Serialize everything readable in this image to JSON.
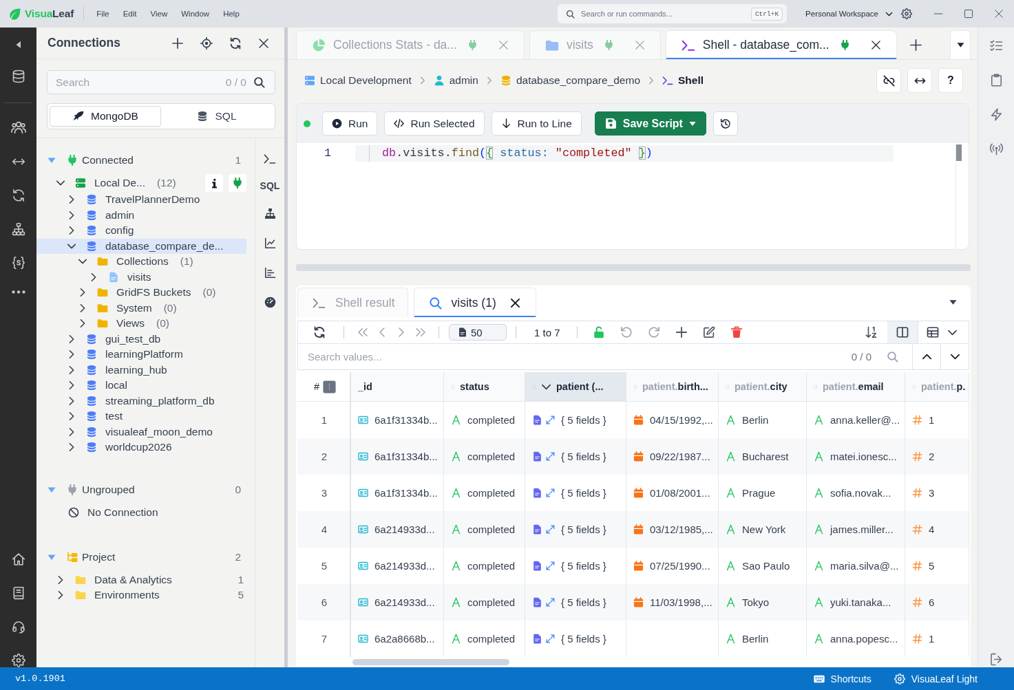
{
  "title_bar": {
    "logo": {
      "prefix": "Visua",
      "suffix": "Leaf"
    },
    "menu": [
      "File",
      "Edit",
      "View",
      "Window",
      "Help"
    ],
    "command_search": {
      "placeholder": "Search or run commands...",
      "shortcut": "Ctrl+K"
    },
    "workspace": "Personal Workspace"
  },
  "connections_panel": {
    "title": "Connections",
    "search": {
      "placeholder": "Search",
      "count": "0 / 0"
    },
    "db_types": [
      {
        "label": "MongoDB",
        "kind": "mongodb",
        "selected": true
      },
      {
        "label": "SQL",
        "kind": "sql",
        "selected": false
      }
    ],
    "tool_label": "SQL",
    "groups": [
      {
        "name": "Connected",
        "kind": "connected",
        "count": "1",
        "expanded": true,
        "children": [
          {
            "name": "Local De...",
            "kind": "server",
            "count": "(12)",
            "expanded": true,
            "selected": false,
            "children": [
              {
                "name": "TravelPlannerDemo",
                "kind": "database",
                "expanded": false,
                "selected": false
              },
              {
                "name": "admin",
                "kind": "database",
                "expanded": false,
                "selected": false
              },
              {
                "name": "config",
                "kind": "database",
                "expanded": false,
                "selected": false
              },
              {
                "name": "database_compare_de...",
                "kind": "database",
                "expanded": true,
                "selected": true,
                "children": [
                  {
                    "name": "Collections",
                    "kind": "folder",
                    "count": "(1)",
                    "expanded": true,
                    "selected": false,
                    "children": [
                      {
                        "name": "visits",
                        "kind": "collection",
                        "expanded": false,
                        "selected": false
                      }
                    ]
                  },
                  {
                    "name": "GridFS Buckets",
                    "kind": "folder",
                    "count": "(0)",
                    "expanded": false,
                    "selected": false
                  },
                  {
                    "name": "System",
                    "kind": "folder",
                    "count": "(0)",
                    "expanded": false,
                    "selected": false
                  },
                  {
                    "name": "Views",
                    "kind": "folder",
                    "count": "(0)",
                    "expanded": false,
                    "selected": false
                  }
                ]
              },
              {
                "name": "gui_test_db",
                "kind": "database",
                "expanded": false,
                "selected": false
              },
              {
                "name": "learningPlatform",
                "kind": "database",
                "expanded": false,
                "selected": false
              },
              {
                "name": "learning_hub",
                "kind": "database",
                "expanded": false,
                "selected": false
              },
              {
                "name": "local",
                "kind": "database",
                "expanded": false,
                "selected": false
              },
              {
                "name": "streaming_platform_db",
                "kind": "database",
                "expanded": false,
                "selected": false
              },
              {
                "name": "test",
                "kind": "database",
                "expanded": false,
                "selected": false
              },
              {
                "name": "visualeaf_moon_demo",
                "kind": "database",
                "expanded": false,
                "selected": false
              },
              {
                "name": "worldcup2026",
                "kind": "database",
                "expanded": false,
                "selected": false
              }
            ]
          }
        ]
      },
      {
        "name": "Ungrouped",
        "kind": "ungrouped",
        "count": "0",
        "expanded": true,
        "children": [
          {
            "name": "No Connection",
            "kind": "empty"
          }
        ]
      },
      {
        "name": "Project",
        "kind": "project",
        "count": "2",
        "expanded": true,
        "children": [
          {
            "name": "Data & Analytics",
            "kind": "project_folder",
            "count": "1",
            "expanded": false,
            "selected": false
          },
          {
            "name": "Environments",
            "kind": "project_folder",
            "count": "5",
            "expanded": false,
            "selected": false
          }
        ]
      }
    ]
  },
  "editor_tabs": [
    {
      "label": "Collections Stats - da...",
      "kind": "stats",
      "selected": false
    },
    {
      "label": "visits",
      "kind": "collection",
      "selected": false
    },
    {
      "label": "Shell - database_com...",
      "kind": "shell",
      "selected": true
    }
  ],
  "breadcrumb": [
    {
      "label": "Local Development",
      "kind": "server"
    },
    {
      "label": "admin",
      "kind": "user"
    },
    {
      "label": "database_compare_demo",
      "kind": "database"
    },
    {
      "label": "Shell",
      "kind": "shell"
    }
  ],
  "help_button": "?",
  "editor": {
    "connected": true,
    "buttons": [
      {
        "label": "Run",
        "kind": "run"
      },
      {
        "label": "Run Selected",
        "kind": "run_selected"
      },
      {
        "label": "Run to Line",
        "kind": "run_to_line"
      },
      {
        "label": "Save Script",
        "kind": "save"
      }
    ],
    "lines": [
      {
        "number": "1",
        "tokens": [
          {
            "text": "db",
            "kind": "keyword"
          },
          {
            "text": ".visits.",
            "kind": "plain"
          },
          {
            "text": "find",
            "kind": "function"
          },
          {
            "text": "(",
            "kind": "paren"
          },
          {
            "text": "{",
            "kind": "brace"
          },
          {
            "text": " status: ",
            "kind": "property"
          },
          {
            "text": "\"completed\" ",
            "kind": "string"
          },
          {
            "text": "}",
            "kind": "brace"
          },
          {
            "text": ")",
            "kind": "paren"
          }
        ]
      }
    ]
  },
  "results": {
    "tabs": [
      {
        "label": "Shell result",
        "kind": "shell",
        "selected": false
      },
      {
        "label": "visits (1)",
        "kind": "query",
        "selected": true
      }
    ],
    "page_size": "50",
    "range": "1 to 7",
    "locked": false,
    "columns_panel_on": true,
    "search": {
      "placeholder": "Search values...",
      "count": "0 / 0"
    },
    "table": {
      "index_header": "#",
      "columns": [
        {
          "label": "_id",
          "kind": "id"
        },
        {
          "label": "status",
          "kind": "field"
        },
        {
          "label": "patient (...",
          "kind": "object",
          "expanded": true
        },
        {
          "prefix": "patient.",
          "label": "birth...",
          "kind": "nested"
        },
        {
          "prefix": "patient.",
          "label": "city",
          "kind": "nested"
        },
        {
          "prefix": "patient.",
          "label": "email",
          "kind": "nested"
        },
        {
          "prefix": "patient.",
          "label": "p.",
          "kind": "nested"
        }
      ],
      "rows": [
        {
          "number": "1",
          "cells": [
            {
              "kind": "objectid",
              "value": "6a1f31334b..."
            },
            {
              "kind": "string",
              "value": "completed"
            },
            {
              "kind": "object",
              "value": "{ 5 fields }"
            },
            {
              "kind": "date",
              "value": "04/15/1992,..."
            },
            {
              "kind": "string",
              "value": "Berlin"
            },
            {
              "kind": "string",
              "value": "anna.keller@..."
            },
            {
              "kind": "number",
              "value": "1"
            }
          ]
        },
        {
          "number": "2",
          "cells": [
            {
              "kind": "objectid",
              "value": "6a1f31334b..."
            },
            {
              "kind": "string",
              "value": "completed"
            },
            {
              "kind": "object",
              "value": "{ 5 fields }"
            },
            {
              "kind": "date",
              "value": "09/22/1987..."
            },
            {
              "kind": "string",
              "value": "Bucharest"
            },
            {
              "kind": "string",
              "value": "matei.ionesc..."
            },
            {
              "kind": "number",
              "value": "2"
            }
          ]
        },
        {
          "number": "3",
          "cells": [
            {
              "kind": "objectid",
              "value": "6a1f31334b..."
            },
            {
              "kind": "string",
              "value": "completed"
            },
            {
              "kind": "object",
              "value": "{ 5 fields }"
            },
            {
              "kind": "date",
              "value": "01/08/2001..."
            },
            {
              "kind": "string",
              "value": "Prague"
            },
            {
              "kind": "string",
              "value": "sofia.novak..."
            },
            {
              "kind": "number",
              "value": "3"
            }
          ]
        },
        {
          "number": "4",
          "cells": [
            {
              "kind": "objectid",
              "value": "6a214933d..."
            },
            {
              "kind": "string",
              "value": "completed"
            },
            {
              "kind": "object",
              "value": "{ 5 fields }"
            },
            {
              "kind": "date",
              "value": "03/12/1985,..."
            },
            {
              "kind": "string",
              "value": "New York"
            },
            {
              "kind": "string",
              "value": "james.miller..."
            },
            {
              "kind": "number",
              "value": "4"
            }
          ]
        },
        {
          "number": "5",
          "cells": [
            {
              "kind": "objectid",
              "value": "6a214933d..."
            },
            {
              "kind": "string",
              "value": "completed"
            },
            {
              "kind": "object",
              "value": "{ 5 fields }"
            },
            {
              "kind": "date",
              "value": "07/25/1990..."
            },
            {
              "kind": "string",
              "value": "Sao Paulo"
            },
            {
              "kind": "string",
              "value": "maria.silva@..."
            },
            {
              "kind": "number",
              "value": "5"
            }
          ]
        },
        {
          "number": "6",
          "cells": [
            {
              "kind": "objectid",
              "value": "6a214933d..."
            },
            {
              "kind": "string",
              "value": "completed"
            },
            {
              "kind": "object",
              "value": "{ 5 fields }"
            },
            {
              "kind": "date",
              "value": "11/03/1998,..."
            },
            {
              "kind": "string",
              "value": "Tokyo"
            },
            {
              "kind": "string",
              "value": "yuki.tanaka..."
            },
            {
              "kind": "number",
              "value": "6"
            }
          ]
        },
        {
          "number": "7",
          "cells": [
            {
              "kind": "objectid",
              "value": "6a2a8668b..."
            },
            {
              "kind": "string",
              "value": "completed"
            },
            {
              "kind": "object",
              "value": "{ 5 fields }"
            },
            {
              "kind": "missing"
            },
            {
              "kind": "string",
              "value": "Berlin"
            },
            {
              "kind": "string",
              "value": "anna.popesc..."
            },
            {
              "kind": "number",
              "value": "1"
            }
          ]
        }
      ]
    }
  },
  "status_bar": {
    "version": "v1.0.1901",
    "items": [
      {
        "label": "Shortcuts",
        "kind": "shortcuts"
      },
      {
        "label": "VisuaLeaf Light",
        "kind": "theme"
      }
    ]
  }
}
